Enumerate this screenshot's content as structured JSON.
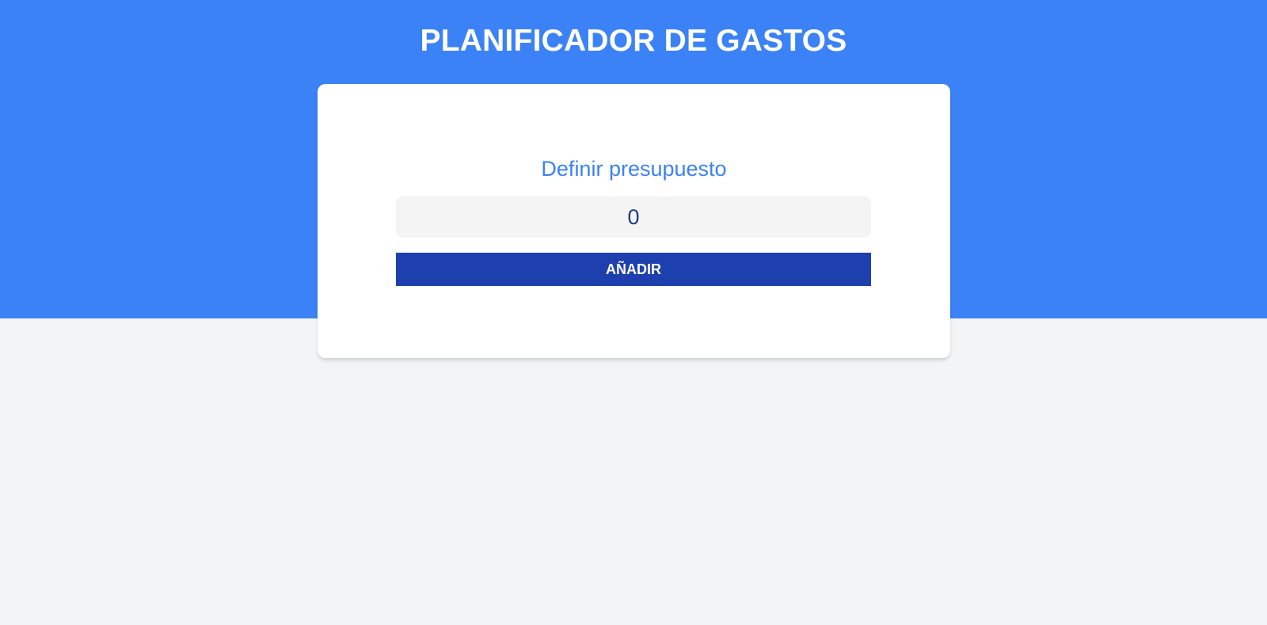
{
  "header": {
    "title": "PLANIFICADOR DE GASTOS"
  },
  "budget_form": {
    "label": "Definir presupuesto",
    "input_value": "0",
    "submit_label": "AÑADIR"
  },
  "colors": {
    "accent": "#3b82f6",
    "button": "#1e40af",
    "background": "#f3f4f6"
  }
}
